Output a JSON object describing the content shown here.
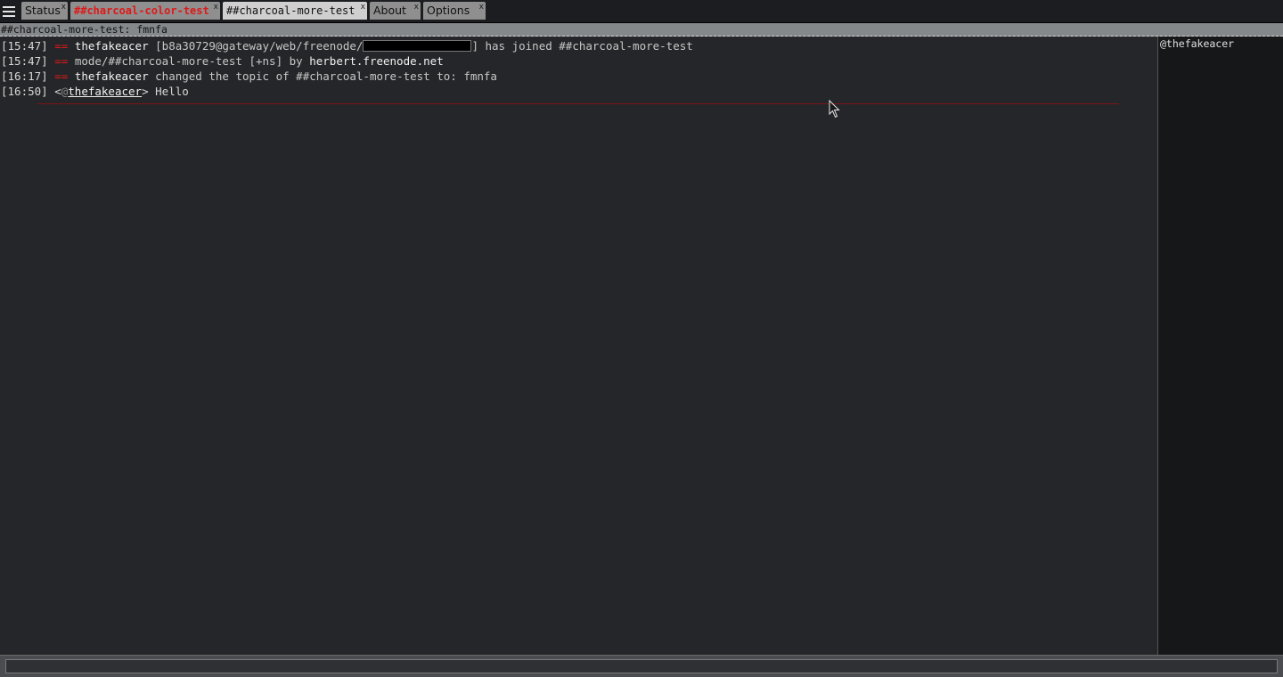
{
  "tabs": [
    {
      "label": "Status",
      "close": "x"
    },
    {
      "label": "##charcoal-color-test",
      "close": "x"
    },
    {
      "label": "##charcoal-more-test",
      "close": "x"
    },
    {
      "label": "About",
      "close": "x"
    },
    {
      "label": "Options",
      "close": "x"
    }
  ],
  "topic": "##charcoal-more-test: fmnfa",
  "messages": [
    {
      "ts": "[15:47]",
      "marker": "==",
      "nick": "thefakeacer",
      "pre": "[b8a30729@gateway/web/freenode/",
      "post": "] has joined ##charcoal-more-test"
    },
    {
      "ts": "[15:47]",
      "marker": "==",
      "text": "mode/##charcoal-more-test [+ns] by ",
      "nick": "herbert.freenode.net"
    },
    {
      "ts": "[16:17]",
      "marker": "==",
      "nick": "thefakeacer",
      "text": "changed the topic of ##charcoal-more-test to: fmnfa"
    },
    {
      "ts": "[16:50]",
      "open": "<",
      "prefix": "@",
      "nick": "thefakeacer",
      "close": ">",
      "text": "Hello"
    }
  ],
  "nicklist": [
    "@thefakeacer"
  ],
  "input": {
    "value": "",
    "placeholder": ""
  },
  "colors": {
    "alert": "#e01818",
    "marker": "#e01818",
    "background": "#252629",
    "nicklist_bg": "#161719"
  }
}
